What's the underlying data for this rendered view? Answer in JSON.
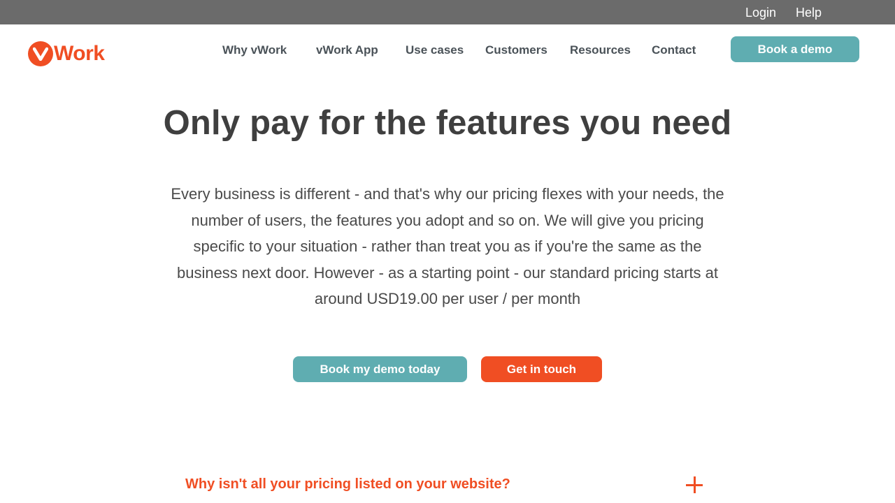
{
  "colors": {
    "accent": "#f04e23",
    "teal": "#5fadb1",
    "topbar": "#6b6b6b",
    "text": "#444444"
  },
  "topbar": {
    "login": "Login",
    "help": "Help"
  },
  "logo": {
    "text": "Work",
    "icon": "v-logo-icon"
  },
  "nav": {
    "items": [
      "Why vWork",
      "vWork App",
      "Use cases",
      "Customers",
      "Resources",
      "Contact"
    ],
    "demo_button": "Book a demo"
  },
  "hero": {
    "title": "Only pay for the features you need",
    "text": "Every business is different - and that's why our pricing flexes with your needs, the number of users, the features you adopt and so on. We will  give you pricing specific to your situation - rather than treat you as if you're the same as the business next door. However - as a starting point - our standard pricing starts at around USD19.00 per user / per month"
  },
  "cta": {
    "primary": "Book my demo today",
    "secondary": "Get in touch"
  },
  "faq": {
    "items": [
      {
        "question": "Why isn't all your pricing listed on your website?",
        "icon": "plus-icon"
      }
    ]
  }
}
